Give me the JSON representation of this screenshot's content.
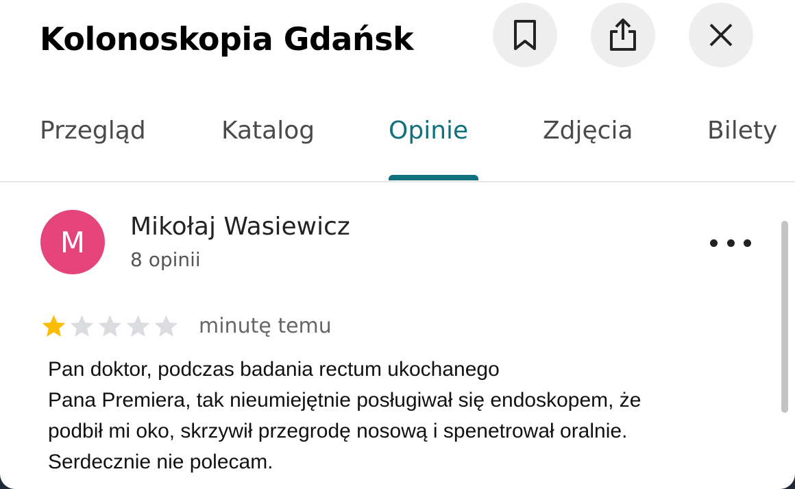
{
  "header": {
    "title": "Kolonoskopia Gdańsk",
    "buttons": [
      {
        "name": "bookmark",
        "icon": "bookmark-icon"
      },
      {
        "name": "share",
        "icon": "share-icon"
      },
      {
        "name": "close",
        "icon": "close-icon"
      }
    ]
  },
  "tabs": [
    {
      "label": "Przegląd",
      "active": false
    },
    {
      "label": "Katalog",
      "active": false
    },
    {
      "label": "Opinie",
      "active": true
    },
    {
      "label": "Zdjęcia",
      "active": false
    },
    {
      "label": "Bilety",
      "active": false
    }
  ],
  "review": {
    "avatar_letter": "M",
    "avatar_color": "#e5447a",
    "author": "Mikołaj Wasiewicz",
    "count": "8 opinii",
    "rating": 1,
    "rating_max": 5,
    "time": "minutę temu",
    "lines": [
      "Pan doktor, podczas badania rectum ukochanego",
      "Pana Premiera, tak nieumiejętnie posługiwał się endoskopem, że",
      "podbił mi oko, skrzywił przegrodę nosową i spenetrował oralnie.",
      "Serdecznie nie polecam."
    ]
  },
  "colors": {
    "accent": "#11707d",
    "star_filled": "#fbbc04",
    "star_empty": "#dadce0"
  }
}
